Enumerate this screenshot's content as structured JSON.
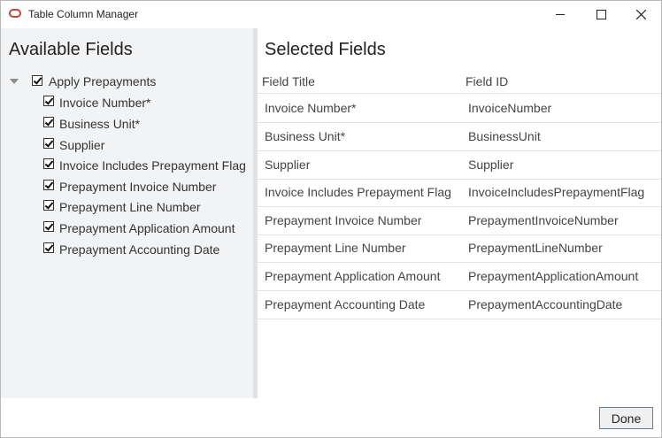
{
  "window": {
    "title": "Table Column Manager"
  },
  "left": {
    "title": "Available Fields",
    "root_label": "Apply Prepayments",
    "items": [
      "Invoice Number*",
      "Business Unit*",
      "Supplier",
      "Invoice Includes Prepayment Flag",
      "Prepayment Invoice Number",
      "Prepayment Line Number",
      "Prepayment Application Amount",
      "Prepayment Accounting Date"
    ]
  },
  "right": {
    "title": "Selected Fields",
    "headers": {
      "title": "Field Title",
      "id": "Field ID"
    },
    "rows": [
      {
        "title": "Invoice Number*",
        "id": "InvoiceNumber"
      },
      {
        "title": "Business Unit*",
        "id": "BusinessUnit"
      },
      {
        "title": "Supplier",
        "id": "Supplier"
      },
      {
        "title": "Invoice Includes Prepayment Flag",
        "id": "InvoiceIncludesPrepaymentFlag"
      },
      {
        "title": "Prepayment Invoice Number",
        "id": "PrepaymentInvoiceNumber"
      },
      {
        "title": "Prepayment Line Number",
        "id": "PrepaymentLineNumber"
      },
      {
        "title": "Prepayment Application Amount",
        "id": "PrepaymentApplicationAmount"
      },
      {
        "title": "Prepayment Accounting Date",
        "id": "PrepaymentAccountingDate"
      }
    ]
  },
  "footer": {
    "done_label": "Done"
  },
  "colors": {
    "accent": "#c74634",
    "button_border": "#5b7fa6"
  }
}
